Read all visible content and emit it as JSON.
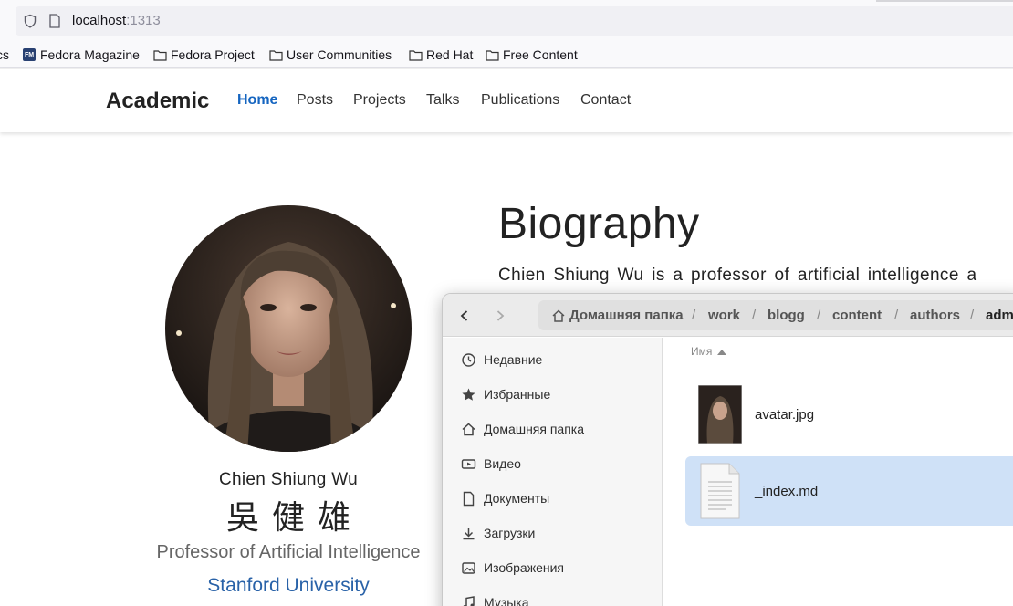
{
  "browser": {
    "url_host": "localhost",
    "url_port": ":1313",
    "bookmarks": [
      {
        "label": "cs"
      },
      {
        "label": "Fedora Magazine",
        "badge": "FM"
      },
      {
        "label": "Fedora Project"
      },
      {
        "label": "User Communities"
      },
      {
        "label": "Red Hat"
      },
      {
        "label": "Free Content"
      }
    ]
  },
  "site": {
    "brand": "Academic",
    "nav": [
      "Home",
      "Posts",
      "Projects",
      "Talks",
      "Publications",
      "Contact"
    ],
    "active_nav": "Home"
  },
  "profile": {
    "name": "Chien Shiung Wu",
    "name_cn": "吳健雄",
    "role": "Professor of Artificial Intelligence",
    "organization": "Stanford University"
  },
  "biography": {
    "title": "Biography",
    "text_visible": "Chien Shiung Wu is a professor of artificial intelligence a"
  },
  "file_dialog": {
    "breadcrumbs": [
      "Домашняя папка",
      "work",
      "blogg",
      "content",
      "authors",
      "adm"
    ],
    "sidebar": [
      {
        "label": "Недавние",
        "icon": "clock-icon"
      },
      {
        "label": "Избранные",
        "icon": "star-icon"
      },
      {
        "label": "Домашняя папка",
        "icon": "home-icon"
      },
      {
        "label": "Видео",
        "icon": "video-icon"
      },
      {
        "label": "Документы",
        "icon": "document-icon"
      },
      {
        "label": "Загрузки",
        "icon": "download-icon"
      },
      {
        "label": "Изображения",
        "icon": "image-icon"
      },
      {
        "label": "Музыка",
        "icon": "music-icon"
      }
    ],
    "column_header": "Имя",
    "files": [
      {
        "name": "avatar.jpg",
        "selected": false,
        "icon": "image-thumbnail"
      },
      {
        "name": "_index.md",
        "selected": true,
        "icon": "text-file-icon"
      }
    ]
  },
  "colors": {
    "accent_link": "#1565c0",
    "selection": "#cfe1f7"
  }
}
